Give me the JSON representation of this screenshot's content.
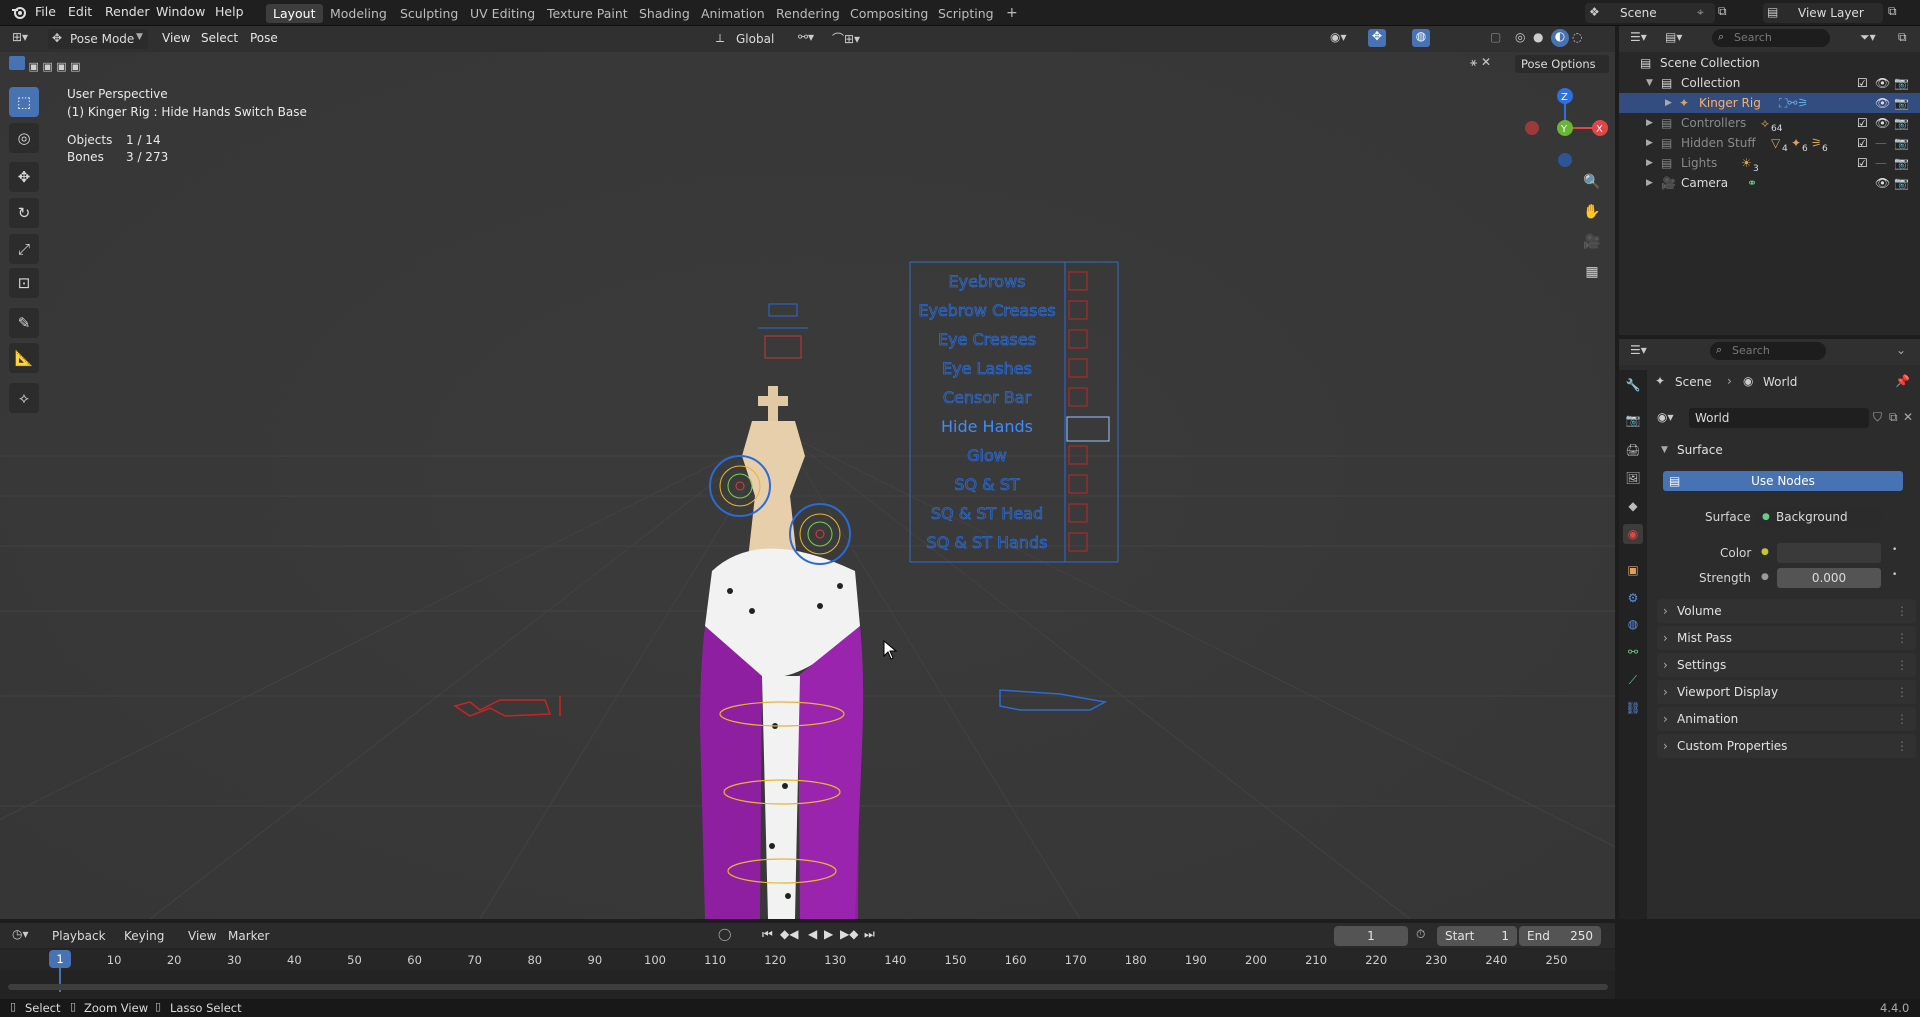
{
  "app": {
    "version": "4.4.0"
  },
  "topbar": {
    "menus": [
      "File",
      "Edit",
      "Render",
      "Window",
      "Help"
    ],
    "workspaces": [
      "Layout",
      "Modeling",
      "Sculpting",
      "UV Editing",
      "Texture Paint",
      "Shading",
      "Animation",
      "Rendering",
      "Compositing",
      "Scripting",
      "+"
    ],
    "active_workspace": "Layout",
    "scene": "Scene",
    "view_layer": "View Layer"
  },
  "viewport_header": {
    "mode": "Pose Mode",
    "menus": [
      "View",
      "Select",
      "Pose"
    ],
    "orientation": "Global",
    "pose_options": "Pose Options"
  },
  "overlay_text": {
    "perspective": "User Perspective",
    "active": "(1) Kinger Rig : Hide Hands Switch Base",
    "objects_label": "Objects",
    "objects_value": "1 / 14",
    "bones_label": "Bones",
    "bones_value": "3 / 273"
  },
  "gizmo": {
    "z": "Z",
    "y": "Y",
    "x": "X"
  },
  "control_panel": {
    "items": [
      "Eyebrows",
      "Eyebrow Creases",
      "Eye Creases",
      "Eye Lashes",
      "Censor Bar",
      "Hide Hands",
      "Glow",
      "SQ & ST",
      "SQ & ST Head",
      "SQ & ST Hands"
    ],
    "active": "Hide Hands"
  },
  "outliner": {
    "search_placeholder": "Search",
    "root": "Scene Collection",
    "items": [
      {
        "label": "Collection"
      },
      {
        "label": "Kinger Rig"
      },
      {
        "label": "Controllers",
        "count": "64"
      },
      {
        "label": "Hidden Stuff",
        "count_a": "4",
        "count_b": "6",
        "count_c": "6"
      },
      {
        "label": "Lights",
        "count": "3"
      },
      {
        "label": "Camera"
      }
    ]
  },
  "properties": {
    "search_placeholder": "Search",
    "breadcrumb_scene": "Scene",
    "breadcrumb_world": "World",
    "world_name": "World",
    "surface_panel": "Surface",
    "use_nodes": "Use Nodes",
    "surface_label": "Surface",
    "surface_value": "Background",
    "color_label": "Color",
    "color_value": "#3a3a3a",
    "strength_label": "Strength",
    "strength_value": "0.000",
    "sections": [
      "Volume",
      "Mist Pass",
      "Settings",
      "Viewport Display",
      "Animation",
      "Custom Properties"
    ]
  },
  "timeline": {
    "menus": [
      "Playback",
      "Keying",
      "View",
      "Marker"
    ],
    "current_frame": "1",
    "start_label": "Start",
    "start_value": "1",
    "end_label": "End",
    "end_value": "250",
    "ticks": [
      "1",
      "10",
      "20",
      "30",
      "40",
      "50",
      "60",
      "70",
      "80",
      "90",
      "100",
      "110",
      "120",
      "130",
      "140",
      "150",
      "160",
      "170",
      "180",
      "190",
      "200",
      "210",
      "220",
      "230",
      "240",
      "250"
    ]
  },
  "statusbar": {
    "items": [
      "Select",
      "Zoom View",
      "Lasso Select"
    ],
    "version": "4.4.0"
  },
  "colors": {
    "accent": "#4772b3",
    "rig_blue": "#2a6bd6",
    "robe": "#8e1fa0"
  }
}
